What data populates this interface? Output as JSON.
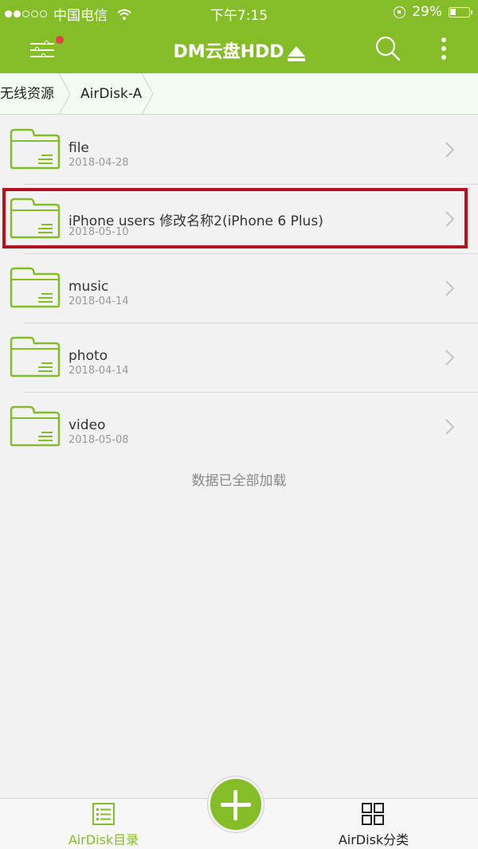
{
  "status_bar": {
    "carrier": "中国电信",
    "time": "下午7:15",
    "battery": "29%"
  },
  "header": {
    "title": "DM云盘HDD",
    "icons": [
      "menu-settings-icon",
      "eject-icon",
      "search-icon",
      "more-vertical-icon"
    ]
  },
  "breadcrumb": {
    "items": [
      {
        "label": "无线资源"
      },
      {
        "label": "AirDisk-A"
      }
    ]
  },
  "files": [
    {
      "name": "file",
      "date": "2018-04-28",
      "icon": "folder-icon"
    },
    {
      "name": "iPhone users 修改名称2(iPhone 6 Plus)",
      "date": "2018-05-10",
      "icon": "folder-icon",
      "highlighted": true
    },
    {
      "name": "music",
      "date": "2018-04-14",
      "icon": "folder-icon"
    },
    {
      "name": "photo",
      "date": "2018-04-14",
      "icon": "folder-icon"
    },
    {
      "name": "video",
      "date": "2018-05-08",
      "icon": "folder-icon"
    }
  ],
  "load_status": "数据已全部加载",
  "tab_bar": {
    "tabs": [
      {
        "label": "AirDisk目录",
        "icon": "list-icon",
        "active": true
      },
      {
        "label": "AirDisk分类",
        "icon": "grid-icon",
        "active": false
      }
    ],
    "add_button_icon": "plus-icon"
  },
  "colors": {
    "brand_green": "#84bd27",
    "highlight_red": "#b5121b",
    "breadcrumb_bg": "#f3fcf2",
    "notification_dot": "#e84141"
  }
}
